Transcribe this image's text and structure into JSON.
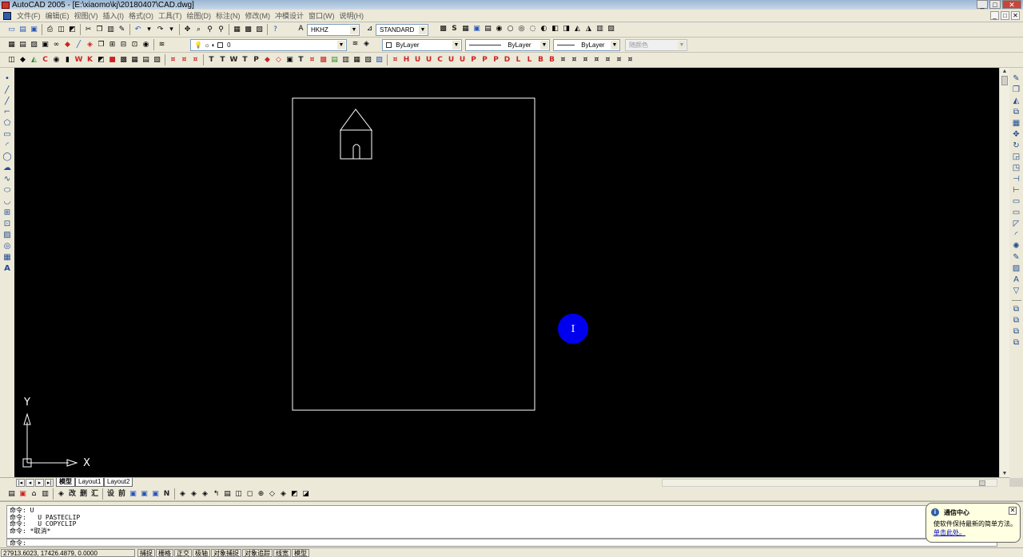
{
  "window": {
    "title": "AutoCAD 2005 - [E:\\xiaomo\\kj\\20180407\\CAD.dwg]",
    "controls": [
      "_",
      "□",
      "✕"
    ]
  },
  "menu": {
    "items": [
      "文件(F)",
      "编辑(E)",
      "视图(V)",
      "插入(I)",
      "格式(O)",
      "工具(T)",
      "绘图(D)",
      "标注(N)",
      "修改(M)",
      "冲模设计",
      "窗口(W)",
      "说明(H)"
    ],
    "mdi_controls": [
      "_",
      "□",
      "✕"
    ]
  },
  "toolbar_styles": {
    "text_style": "HKHZ",
    "dim_style": "STANDARD"
  },
  "toolbar_layers": {
    "current_layer": "0",
    "color": "ByLayer",
    "linetype": "ByLayer",
    "lineweight": "ByLayer",
    "plot_style": "随颜色"
  },
  "drawing": {
    "background": "#000000",
    "line_color": "#ffffff",
    "cursor_color": "#0000ee",
    "cursor_glyph": "I",
    "ucs": {
      "y_label": "Y",
      "x_label": "X"
    }
  },
  "layout_tabs": [
    "模型",
    "Layout1",
    "Layout2"
  ],
  "command": {
    "history": [
      "命令: U",
      "命令:   U PASTECLIP",
      "命令:   U COPYCLIP",
      "命令: *取消*"
    ],
    "prompt": "命令:"
  },
  "notification": {
    "title": "通信中心",
    "body": "使软件保持最新的简单方法。",
    "link": "单击此处。",
    "icon": "info-icon"
  },
  "status": {
    "coordinates": "27913.6023,  17426.4879,  0.0000",
    "toggles": [
      "捕捉",
      "栅格",
      "正交",
      "极轴",
      "对象捕捉",
      "对象追踪",
      "线宽",
      "模型"
    ]
  }
}
